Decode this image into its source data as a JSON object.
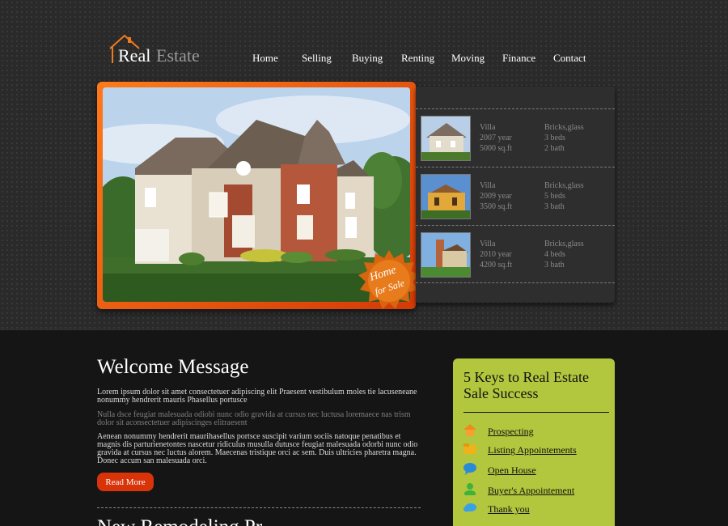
{
  "logo": {
    "word1": "Real",
    "word2": "Estate"
  },
  "nav": [
    "Home",
    "Selling",
    "Buying",
    "Renting",
    "Moving",
    "Finance",
    "Contact"
  ],
  "hero": {
    "badge_line1": "Home",
    "badge_line2": "for Sale"
  },
  "listings": [
    {
      "type": "Villa",
      "year": "2007 year",
      "size": "5000 sq.ft",
      "material": "Bricks,glass",
      "beds": "3 beds",
      "baths": "2 bath"
    },
    {
      "type": "Villa",
      "year": "2009 year",
      "size": "3500 sq.ft",
      "material": "Bricks,glass",
      "beds": "5 beds",
      "baths": "3 bath"
    },
    {
      "type": "Villa",
      "year": "2010 year",
      "size": "4200 sq.ft",
      "material": "Bricks,glass",
      "beds": "4 beds",
      "baths": "3 bath"
    }
  ],
  "welcome": {
    "title": "Welcome Message",
    "p1": "Lorem ipsum dolor sit amet consectetuer adipiscing elit Praesent vestibulum moles tie lacuseneane nonummy hendrerit mauris Phasellus portusce",
    "p2": "Nulla dsce feugiat malesuada odiobi nunc odio gravida at cursus nec luctusa loremaece nas trism dolor sit aconsectetuer adipiscinges elitraesent",
    "p3": "Aenean nonummy hendrerit maurihasellus portsce suscipit varium sociis natoque penatibus et magnis dis parturienetontes nascetur ridiculus musulla dutusce feugiat malesuada odorbi nunc odio gravida at cursus nec luctus alorem. Maecenas tristique orci ac sem. Duis ultricies pharetra magna. Donec accum san malesuada orci.",
    "read_more": "Read More",
    "next_heading": "New Remodeling Pr"
  },
  "keys": {
    "title": "5 Keys to Real Estate Sale Success",
    "items": [
      {
        "label": "Prospecting",
        "icon": "home-icon"
      },
      {
        "label": "Listing Appointements",
        "icon": "folder-icon"
      },
      {
        "label": "Open House",
        "icon": "speech-bubble-icon"
      },
      {
        "label": "Buyer's Appointement",
        "icon": "user-icon"
      },
      {
        "label": "Thank you",
        "icon": "cloud-icon"
      }
    ]
  },
  "colors": {
    "accent_orange": "#e8590c",
    "panel_green": "#b2c63e",
    "button_red": "#d9330a"
  }
}
